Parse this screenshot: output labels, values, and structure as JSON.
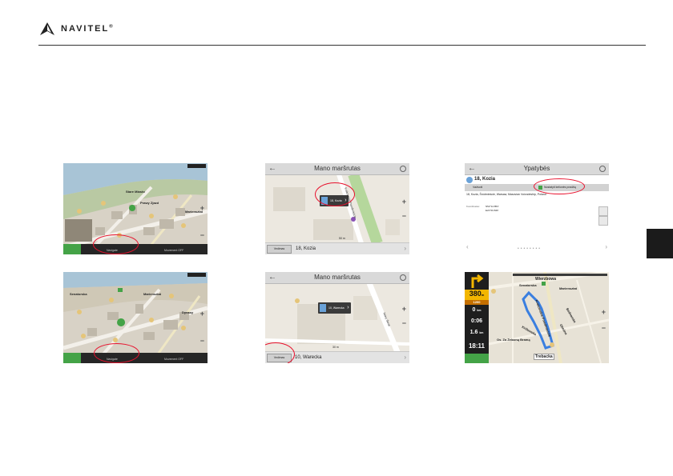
{
  "brand": {
    "name": "NAVITEL",
    "reg": "®"
  },
  "screens": {
    "s1": {
      "labels": [
        "Stare Miasto",
        "Prawy Zjazd",
        "Mariensztat"
      ],
      "btn": "Navigate",
      "btn2": "Movement OFF",
      "time": "0:00"
    },
    "s2": {
      "title": "Mano maršrutas",
      "bubble": "18, Kozia",
      "street": "Krakowskie Przedmieście",
      "btn": "Vedimas",
      "addr": "18, Kozia",
      "scale": "50 m"
    },
    "s3": {
      "title": "Ypatybės",
      "place": "18, Kozia",
      "sub1": "Važiuoti",
      "sub2": "Nustatyti kelionės pradžią",
      "address": "18, Kozia, Śródmieście, Warsaw, Masovian Voivodeship, Poland",
      "coords_label": "Koordinatės:",
      "coords1": "N52°14.853'",
      "coords2": "E21°00.846'"
    },
    "s4": {
      "labels": [
        "Senatorska",
        "Mariensztat",
        "Dynasy"
      ],
      "btn": "Navigate",
      "btn2": "Movement OFF"
    },
    "s5": {
      "title": "Mano maršrutas",
      "bubble": "10, Warecka",
      "street": "Nowy Świat",
      "btn": "Vedimas",
      "addr": "10, Warecka",
      "scale": "30 m"
    },
    "s6": {
      "speed": "380",
      "speed_sub": "m",
      "sub_dist": "1200",
      "dist1": "0",
      "dist1_unit": "km",
      "time1": "0:06",
      "dist2": "1.6",
      "dist2_unit": "km",
      "clock": "18:11",
      "streets": [
        "Wierzbowa",
        "Mariensztat",
        "Krakowskie Przedmieście",
        "Os. Za Żelazną Bramą",
        "Trebacka",
        "Senatorska",
        "Królewska",
        "Bednarska",
        "Oboźna"
      ]
    }
  },
  "colors": {
    "ring": "#e8112d",
    "green": "#44a347",
    "dark": "#262626",
    "route": "#3a7fe0"
  }
}
